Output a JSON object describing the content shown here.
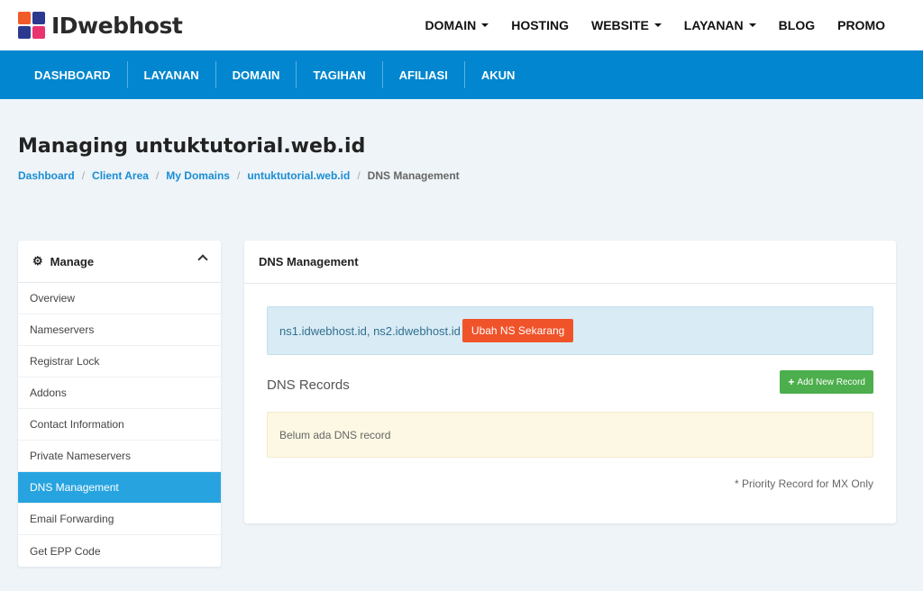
{
  "brand": {
    "name": "IDwebhost"
  },
  "topnav": [
    {
      "label": "DOMAIN",
      "dropdown": true
    },
    {
      "label": "HOSTING",
      "dropdown": false
    },
    {
      "label": "WEBSITE",
      "dropdown": true
    },
    {
      "label": "LAYANAN",
      "dropdown": true
    },
    {
      "label": "BLOG",
      "dropdown": false
    },
    {
      "label": "PROMO",
      "dropdown": false
    }
  ],
  "clientnav": [
    "DASHBOARD",
    "LAYANAN",
    "DOMAIN",
    "TAGIHAN",
    "AFILIASI",
    "AKUN"
  ],
  "page": {
    "title": "Managing untuktutorial.web.id"
  },
  "breadcrumb": {
    "items": [
      "Dashboard",
      "Client Area",
      "My Domains",
      "untuktutorial.web.id"
    ],
    "current": "DNS Management",
    "separator": "/"
  },
  "sidebar": {
    "title": "Manage",
    "items": [
      {
        "label": "Overview",
        "active": false
      },
      {
        "label": "Nameservers",
        "active": false
      },
      {
        "label": "Registrar Lock",
        "active": false
      },
      {
        "label": "Addons",
        "active": false
      },
      {
        "label": "Contact Information",
        "active": false
      },
      {
        "label": "Private Nameservers",
        "active": false
      },
      {
        "label": "DNS Management",
        "active": true
      },
      {
        "label": "Email Forwarding",
        "active": false
      },
      {
        "label": "Get EPP Code",
        "active": false
      }
    ]
  },
  "main": {
    "panel_title": "DNS Management",
    "ns_text": "ns1.idwebhost.id, ns2.idwebhost.id",
    "ns_button": "Ubah NS Sekarang",
    "records_title": "DNS Records",
    "add_button": "Add New Record",
    "empty_text": "Belum ada DNS record",
    "note": "* Priority Record for MX Only"
  },
  "colors": {
    "brand_blue": "#0186cf",
    "active_item": "#27a4e0",
    "ns_button": "#f0532a",
    "add_button": "#4cae4c"
  }
}
